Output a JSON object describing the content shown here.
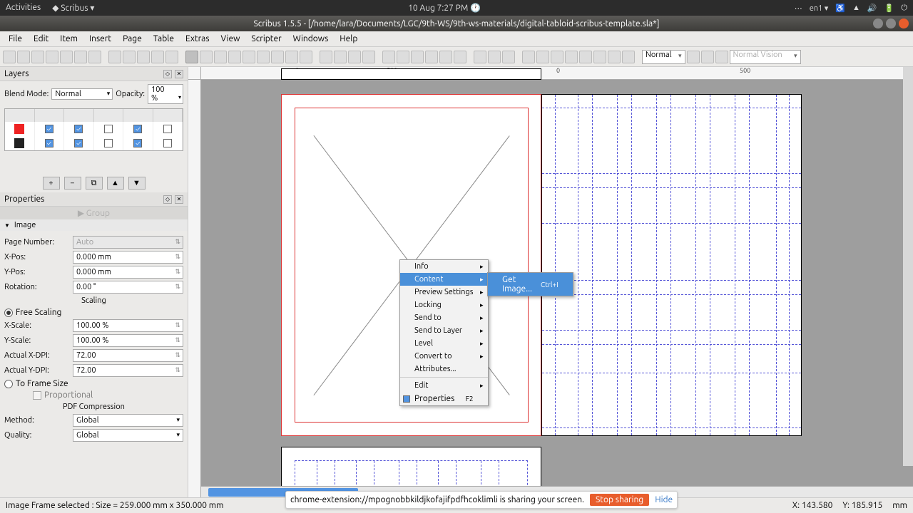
{
  "topbar": {
    "activities": "Activities",
    "app": "Scribus ▾",
    "datetime": "10 Aug   7:27 PM",
    "lang": "en1 ▾"
  },
  "window": {
    "title": "Scribus 1.5.5 - [/home/lara/Documents/LGC/9th-WS/9th-ws-materials/digital-tabloid-scribus-template.sla*]"
  },
  "menu": {
    "items": [
      "File",
      "Edit",
      "Item",
      "Insert",
      "Page",
      "Table",
      "Extras",
      "View",
      "Scripter",
      "Windows",
      "Help"
    ]
  },
  "toolbar": {
    "mode": "Normal",
    "vision": "Normal Vision"
  },
  "layers": {
    "title": "Layers",
    "blend_label": "Blend Mode:",
    "blend_value": "Normal",
    "opacity_label": "Opacity:",
    "opacity_value": "100 %"
  },
  "properties": {
    "title": "Properties",
    "group_label": "Group",
    "active_section": "Image",
    "page_num_label": "Page Number:",
    "page_num_value": "Auto",
    "xpos_label": "X-Pos:",
    "xpos_value": "0.000 mm",
    "ypos_label": "Y-Pos:",
    "ypos_value": "0.000 mm",
    "rotation_label": "Rotation:",
    "rotation_value": "0.00 °",
    "scaling_label": "Scaling",
    "free_label": "Free Scaling",
    "xscale_label": "X-Scale:",
    "xscale_value": "100.00 %",
    "yscale_label": "Y-Scale:",
    "yscale_value": "100.00 %",
    "xdpi_label": "Actual X-DPI:",
    "xdpi_value": "72.00",
    "ydpi_label": "Actual Y-DPI:",
    "ydpi_value": "72.00",
    "toframe_label": "To Frame Size",
    "prop_label": "Proportional",
    "pdf_label": "PDF Compression",
    "method_label": "Method:",
    "method_value": "Global",
    "quality_label": "Quality:",
    "quality_value": "Global"
  },
  "context_menu": {
    "items": [
      {
        "label": "Info",
        "sub": true
      },
      {
        "label": "Content",
        "sub": true,
        "highlight": true
      },
      {
        "label": "Preview Settings",
        "sub": true
      },
      {
        "label": "Locking",
        "sub": true
      },
      {
        "label": "Send to",
        "sub": true
      },
      {
        "label": "Send to Layer",
        "sub": true
      },
      {
        "label": "Level",
        "sub": true
      },
      {
        "label": "Convert to",
        "sub": true
      },
      {
        "label": "Attributes..."
      },
      {
        "sep": true
      },
      {
        "label": "Edit",
        "sub": true
      },
      {
        "label": "Properties",
        "check": true,
        "shortcut": "F2"
      }
    ],
    "submenu": {
      "label": "Get Image...",
      "shortcut": "Ctrl+I"
    }
  },
  "ruler": {
    "ticks_h": [
      "0",
      "500",
      "0",
      "500"
    ],
    "pos_h": [
      132,
      260,
      498,
      630
    ]
  },
  "status": {
    "left": "Image Frame selected : Size = 259.000 mm x 350.000 mm",
    "x": "X: 143.580",
    "y": "Y: 185.915",
    "unit": "mm"
  },
  "share": {
    "msg": "chrome-extension://mpognobbkildjkofajifpdfhcoklimli is sharing your screen.",
    "stop": "Stop sharing",
    "hide": "Hide"
  }
}
